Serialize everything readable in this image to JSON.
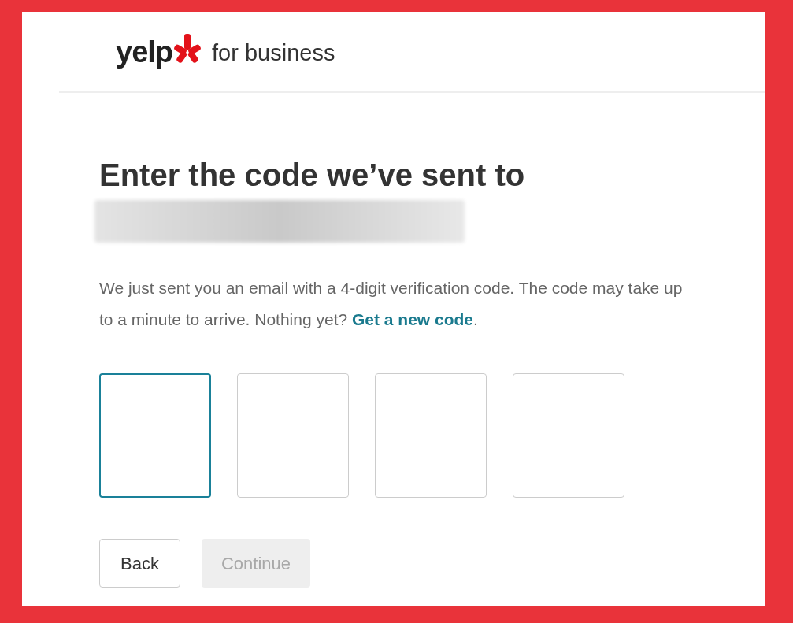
{
  "header": {
    "logo_text": "yelp",
    "subtitle": "for business"
  },
  "heading": "Enter the code we’ve sent to",
  "email": {
    "redacted": true
  },
  "message": {
    "text": "We just sent you an email with a 4-digit verification code. The code may take up to a minute to arrive. Nothing yet?",
    "link": "Get a new code",
    "after": "."
  },
  "code_inputs": [
    {
      "focused": true
    },
    {
      "focused": false
    },
    {
      "focused": false
    },
    {
      "focused": false
    }
  ],
  "buttons": [
    {
      "label": "Back",
      "disabled": false
    },
    {
      "label": "Continue",
      "disabled": true
    }
  ]
}
